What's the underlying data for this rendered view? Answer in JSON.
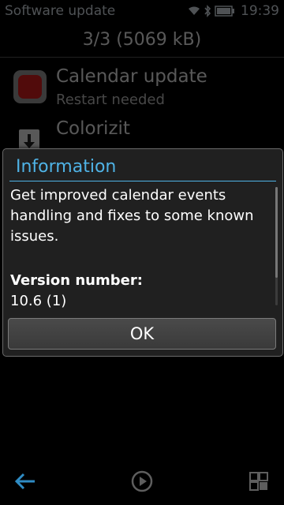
{
  "status_bar": {
    "app_title": "Software update",
    "time": "19:39",
    "icons": [
      "signal-icon",
      "bluetooth-icon",
      "battery-icon"
    ]
  },
  "header": {
    "summary": "3/3 (5069 kB)"
  },
  "list": {
    "items": [
      {
        "title": "Calendar update",
        "subtitle": "Restart needed",
        "icon": "calendar-app-icon"
      },
      {
        "title": "Colorizit",
        "subtitle": "",
        "icon": "download-icon"
      }
    ]
  },
  "dialog": {
    "title": "Information",
    "description": "Get improved calendar events handling and fixes to some known issues.",
    "version_label": "Version number:",
    "version_value": "10.6 (1)",
    "ok_label": "OK"
  },
  "toolbar": {
    "icons": [
      "back-arrow-icon",
      "play-icon",
      "options-grid-icon"
    ]
  },
  "colors": {
    "accent": "#4fb3e6",
    "dialog_bg": "#202020",
    "background": "#000000"
  }
}
